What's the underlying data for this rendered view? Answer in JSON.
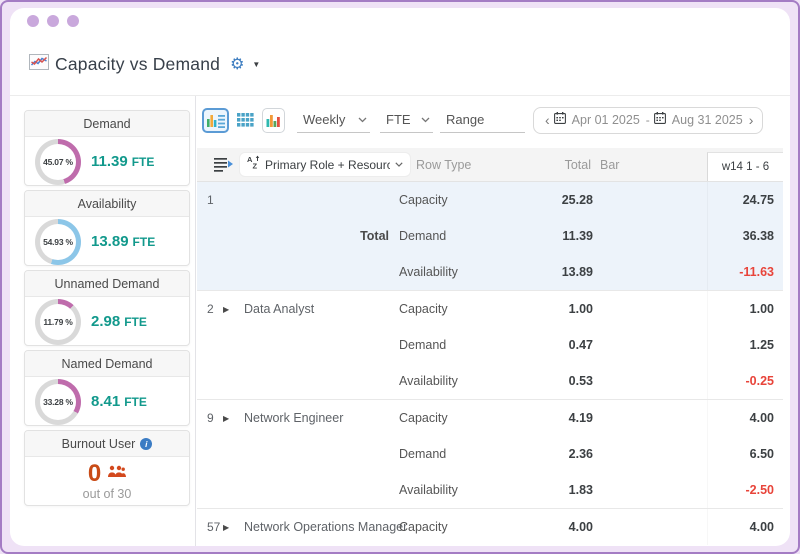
{
  "header": {
    "title": "Capacity vs Demand"
  },
  "icons": {
    "gear": "⚙",
    "caret_down": "▼",
    "row_caret": "▶",
    "prev_chevron": "‹",
    "next_chevron": "›"
  },
  "colors": {
    "accent_teal": "#12998c",
    "burnout_orange": "#c94b16",
    "negative_red": "#e8443a",
    "capacity_green": "#6d8a66",
    "demand_pink": "#c77fb3",
    "availability_blue": "#8ec9e9",
    "frame_purple": "#a47cc4"
  },
  "sidebar": {
    "cards": [
      {
        "title": "Demand",
        "percent": "45.07 %",
        "value": "11.39",
        "unit": "FTE",
        "ring_style": "background:conic-gradient(#bf6cac 0% 45.07%, #d9d9d9 45.07% 100%)"
      },
      {
        "title": "Availability",
        "percent": "54.93 %",
        "value": "13.89",
        "unit": "FTE",
        "ring_style": "background:conic-gradient(#8cc6e8 0% 54.93%, #d9d9d9 54.93% 100%)"
      },
      {
        "title": "Unnamed Demand",
        "percent": "11.79 %",
        "value": "2.98",
        "unit": "FTE",
        "ring_style": "background:conic-gradient(#bf6cac 0% 11.79%, #d9d9d9 11.79% 100%)"
      },
      {
        "title": "Named Demand",
        "percent": "33.28 %",
        "value": "8.41",
        "unit": "FTE",
        "ring_style": "background:conic-gradient(#bf6cac 0% 33.28%, #d9d9d9 33.28% 100%)"
      }
    ],
    "burnout": {
      "title": "Burnout User",
      "count": "0",
      "caption": "out of 30"
    }
  },
  "toolbar": {
    "period_select": "Weekly",
    "unit_select": "FTE",
    "range_select": "Range",
    "date_range": {
      "start": "Apr 01 2025",
      "separator": "-",
      "end": "Aug 31 2025"
    }
  },
  "table": {
    "group_by": "Primary Role + Resource...",
    "headers": {
      "row_type": "Row Type",
      "total": "Total",
      "bar": "Bar",
      "week": "w14 1 - 6"
    },
    "groups": [
      {
        "num": "1",
        "name": "",
        "label": "Total",
        "rows": [
          {
            "type": "Capacity",
            "total": "25.28",
            "week": "24.75",
            "bar_style": "width:72px;background:#6d8a66"
          },
          {
            "type": "Demand",
            "total": "11.39",
            "week": "36.38",
            "bar_style": "width:32px;background:#c77fb3"
          },
          {
            "type": "Availability",
            "total": "13.89",
            "week": "-11.63",
            "bar_style": "width:40px;background:#8ec9e9"
          }
        ]
      },
      {
        "num": "2",
        "name": "Data Analyst",
        "label": "",
        "rows": [
          {
            "type": "Capacity",
            "total": "1.00",
            "week": "1.00",
            "bar_style": "width:72px;background:#6d8a66"
          },
          {
            "type": "Demand",
            "total": "0.47",
            "week": "1.25",
            "bar_style": "width:34px;background:#c77fb3"
          },
          {
            "type": "Availability",
            "total": "0.53",
            "week": "-0.25",
            "bar_style": "width:38px;background:#8ec9e9"
          }
        ]
      },
      {
        "num": "9",
        "name": "Network Engineer",
        "label": "",
        "rows": [
          {
            "type": "Capacity",
            "total": "4.19",
            "week": "4.00",
            "bar_style": "width:72px;background:#6d8a66"
          },
          {
            "type": "Demand",
            "total": "2.36",
            "week": "6.50",
            "bar_style": "width:40px;background:#8f9e95"
          },
          {
            "type": "Availability",
            "total": "1.83",
            "week": "-2.50",
            "bar_style": "width:31px;background:#a9d4ee"
          }
        ]
      },
      {
        "num": "57",
        "name": "Network Operations Manager",
        "label": "",
        "rows": [
          {
            "type": "Capacity",
            "total": "4.00",
            "week": "4.00",
            "bar_style": "width:70px;background:#6d8a66"
          }
        ]
      }
    ]
  }
}
